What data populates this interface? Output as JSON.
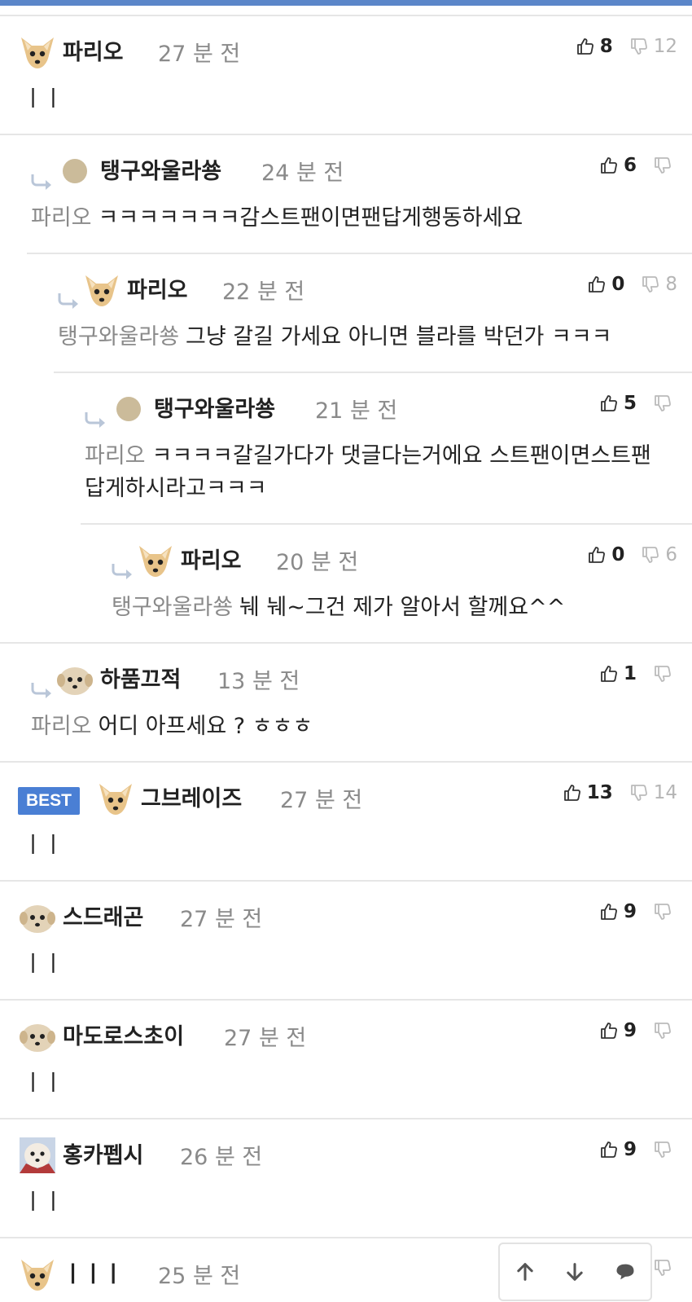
{
  "colors": {
    "accent": "#5b86c9",
    "best_badge": "#4a7fd4",
    "muted": "#8a8a8a"
  },
  "comments": [
    {
      "id": "c1",
      "depth": 0,
      "avatar": "chihuahua-avatar-icon",
      "name": "파리오",
      "time": "27 분 전",
      "up": "8",
      "down": "12",
      "mention": "",
      "text": "ㅣㅣ"
    },
    {
      "id": "c2",
      "depth": 1,
      "avatar": "circle-avatar-icon",
      "name": "탱구와울라쑝",
      "time": "24 분 전",
      "up": "6",
      "down": "",
      "mention": "파리오",
      "text": "ㅋㅋㅋㅋㅋㅋㅋ감스트팬이면팬답게행동하세요"
    },
    {
      "id": "c3",
      "depth": 2,
      "avatar": "chihuahua-avatar-icon",
      "name": "파리오",
      "time": "22 분 전",
      "up": "0",
      "down": "8",
      "mention": "탱구와울라쑝",
      "text": "그냥 갈길 가세요 아니면 블라를 박던가 ㅋㅋㅋ"
    },
    {
      "id": "c4",
      "depth": 3,
      "avatar": "circle-avatar-icon",
      "name": "탱구와울라쑝",
      "time": "21 분 전",
      "up": "5",
      "down": "",
      "mention": "파리오",
      "text": "ㅋㅋㅋㅋ갈길가다가 댓글다는거에요 스트팬이면스트팬답게하시라고ㅋㅋㅋ"
    },
    {
      "id": "c5",
      "depth": 4,
      "avatar": "chihuahua-avatar-icon",
      "name": "파리오",
      "time": "20 분 전",
      "up": "0",
      "down": "6",
      "mention": "탱구와울라쑝",
      "text": "눼 눼~그건 제가 알아서 할께요^^"
    },
    {
      "id": "c6",
      "depth": 1,
      "avatar": "puppy-avatar-icon",
      "name": "하품끄적",
      "time": "13 분 전",
      "up": "1",
      "down": "",
      "mention": "파리오",
      "text": "어디 아프세요 ? ㅎㅎㅎ"
    },
    {
      "id": "c7",
      "depth": 0,
      "best": "BEST",
      "avatar": "chihuahua-avatar-icon",
      "name": "그브레이즈",
      "time": "27 분 전",
      "up": "13",
      "down": "14",
      "mention": "",
      "text": "ㅣㅣ"
    },
    {
      "id": "c8",
      "depth": 0,
      "avatar": "puppy-avatar-icon",
      "name": "스드래곤",
      "time": "27 분 전",
      "up": "9",
      "down": "",
      "mention": "",
      "text": "ㅣㅣ"
    },
    {
      "id": "c9",
      "depth": 0,
      "avatar": "puppy-avatar-icon",
      "name": "마도로스초이",
      "time": "27 분 전",
      "up": "9",
      "down": "",
      "mention": "",
      "text": "ㅣㅣ"
    },
    {
      "id": "c10",
      "depth": 0,
      "avatar": "puppy-photo-avatar-icon",
      "name": "홍카펩시",
      "time": "26 분 전",
      "up": "9",
      "down": "",
      "mention": "",
      "text": "ㅣㅣ"
    },
    {
      "id": "c11",
      "depth": 0,
      "avatar": "chihuahua-avatar-icon",
      "name": "ㅣㅣㅣ",
      "time": "25 분 전",
      "up": "",
      "down": "",
      "mention": "",
      "text": ""
    }
  ],
  "scroll_widget": {
    "up_icon": "arrow-up-icon",
    "down_icon": "arrow-down-icon",
    "comment_icon": "comment-bubble-icon"
  }
}
